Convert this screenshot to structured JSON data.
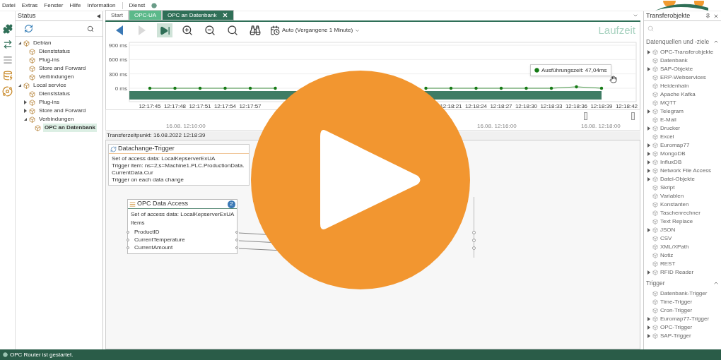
{
  "menu": {
    "items": [
      "Datei",
      "Extras",
      "Fenster",
      "Hilfe",
      "Information"
    ],
    "service": "Dienst"
  },
  "status_panel": {
    "title": "Status",
    "tree": [
      {
        "label": "Debian",
        "expanded": true,
        "children": [
          {
            "label": "Dienststatus"
          },
          {
            "label": "Plug-ins"
          },
          {
            "label": "Store and Forward"
          },
          {
            "label": "Verbindungen"
          }
        ]
      },
      {
        "label": "Local service",
        "expanded": true,
        "children": [
          {
            "label": "Dienststatus"
          },
          {
            "label": "Plug-ins",
            "expanded": false
          },
          {
            "label": "Store and Forward",
            "expanded": false
          },
          {
            "label": "Verbindungen",
            "expanded": true,
            "children": [
              {
                "label": "OPC an Datenbank",
                "selected": true
              }
            ]
          }
        ]
      }
    ]
  },
  "tabs": [
    {
      "label": "Start",
      "selected": false
    },
    {
      "label": "OPC-UA",
      "selected": false,
      "color": "#5cb98a"
    },
    {
      "label": "OPC an Datenbank",
      "selected": true,
      "color": "#2f6f57"
    }
  ],
  "toolbar": {
    "buttons": [
      {
        "kind": "back",
        "selected": false,
        "disabled": false
      },
      {
        "kind": "forward",
        "selected": false,
        "disabled": true
      },
      {
        "kind": "end",
        "selected": true,
        "disabled": false
      },
      {
        "kind": "zoom_in",
        "selected": false,
        "disabled": false
      },
      {
        "kind": "zoom_out",
        "selected": false,
        "disabled": false
      },
      {
        "kind": "zoom_reset",
        "selected": false,
        "disabled": false
      },
      {
        "kind": "find",
        "selected": false,
        "disabled": false
      }
    ],
    "range": "Auto (Vergangene 1 Minute)",
    "title": "Laufzeit"
  },
  "chart": {
    "tooltip": "Ausführungszeit: 47,04ms",
    "chart_data": {
      "type": "line",
      "ylim": [
        0,
        900
      ],
      "yticks": [
        {
          "value": 0,
          "label": "0 ms"
        },
        {
          "value": 300,
          "label": "300 ms"
        },
        {
          "value": 600,
          "label": "600 ms"
        },
        {
          "value": 900,
          "label": "900 ms"
        }
      ],
      "categories": [
        "12:17:45",
        "12:17:48",
        "12:17:51",
        "12:17:54",
        "12:17:57",
        null,
        null,
        null,
        null,
        null,
        null,
        null,
        "12:18:21",
        "12:18:24",
        "12:18:27",
        "12:18:30",
        "12:18:33",
        "12:18:36",
        "12:18:39",
        "12:18:42"
      ],
      "series": [
        {
          "color": "#157a15",
          "values": [
            0,
            0,
            0,
            0,
            0,
            0,
            null,
            null,
            null,
            null,
            null,
            0,
            0,
            0,
            0,
            0,
            0,
            30,
            0,
            null
          ]
        }
      ]
    }
  },
  "navigator": {
    "labels": [
      "16.08. 12:10:00",
      "16.08. 12:16:00",
      "16.08. 12:18:00"
    ]
  },
  "transfer_time": "Transferzeitpunkt: 16.08.2022 12:18:39",
  "trigger_card": {
    "title": "Datachange-Trigger",
    "lines": [
      "Set of access data: LocalKepserverExUA",
      "Trigger item: ns=2;s=Machine1.PLC.ProductionData.CurrentData.Cur",
      "Trigger on each data change"
    ]
  },
  "access_card": {
    "title": "OPC Data Access",
    "badge": "2",
    "access": "Set of access data: LocalKepserverExUA",
    "items_label": "Items",
    "items": [
      "ProductID",
      "CurrentTemperature",
      "CurrentAmount"
    ]
  },
  "transfer_panel": {
    "title": "Transferobjekte",
    "sections": [
      {
        "title": "Datenquellen und -ziele",
        "expanded": true,
        "items": [
          {
            "label": "OPC-Transferobjekte",
            "expanded": false
          },
          {
            "label": "Datenbank"
          },
          {
            "label": "SAP-Objekte",
            "expanded": false
          },
          {
            "label": "ERP-Webservices"
          },
          {
            "label": "Heidenhain"
          },
          {
            "label": "Apache Kafka"
          },
          {
            "label": "MQTT"
          },
          {
            "label": "Telegram",
            "expanded": false
          },
          {
            "label": "E-Mail"
          },
          {
            "label": "Drucker",
            "expanded": false
          },
          {
            "label": "Excel"
          },
          {
            "label": "Euromap77",
            "expanded": false
          },
          {
            "label": "MongoDB",
            "expanded": false
          },
          {
            "label": "InfluxDB",
            "expanded": false
          },
          {
            "label": "Network File Access",
            "expanded": false
          },
          {
            "label": "Datei-Objekte",
            "expanded": false
          },
          {
            "label": "Skript"
          },
          {
            "label": "Variablen"
          },
          {
            "label": "Konstanten"
          },
          {
            "label": "Taschenrechner"
          },
          {
            "label": "Text Replace"
          },
          {
            "label": "JSON",
            "expanded": false
          },
          {
            "label": "CSV"
          },
          {
            "label": "XML/XPath"
          },
          {
            "label": "Notiz"
          },
          {
            "label": "REST"
          },
          {
            "label": "RFID Reader",
            "expanded": false
          }
        ]
      },
      {
        "title": "Trigger",
        "expanded": true,
        "items": [
          {
            "label": "Datenbank-Trigger"
          },
          {
            "label": "Time-Trigger"
          },
          {
            "label": "Cron-Trigger"
          },
          {
            "label": "Euromap77-Trigger",
            "expanded": false
          },
          {
            "label": "OPC-Trigger",
            "expanded": false
          },
          {
            "label": "SAP-Trigger",
            "expanded": false
          }
        ]
      }
    ]
  },
  "status_bar": {
    "text": "OPC Router ist gestartet."
  }
}
